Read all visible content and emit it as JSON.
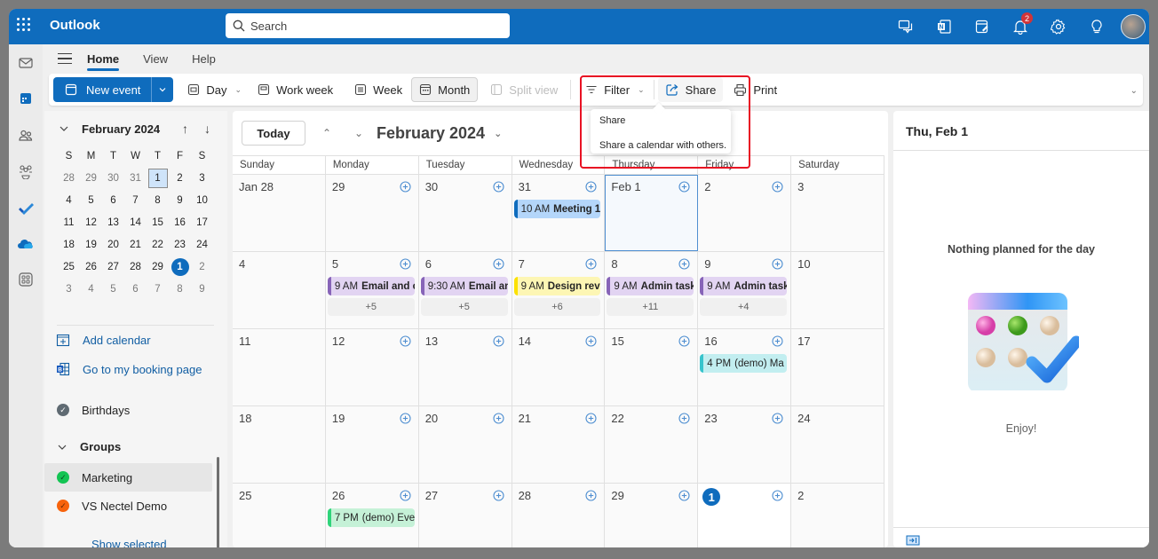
{
  "app": {
    "title": "Outlook",
    "search_placeholder": "Search",
    "notification_count": "2",
    "top_icons": [
      "teams-chat-icon",
      "onenote-icon",
      "my-day-icon",
      "notifications-bell-icon",
      "settings-gear-icon",
      "tips-lightbulb-icon",
      "user-avatar"
    ]
  },
  "rail": {
    "items": [
      "mail",
      "calendar",
      "people",
      "groups",
      "to-do",
      "onedrive",
      "more-apps"
    ],
    "active": "calendar"
  },
  "ribbon": {
    "tabs": [
      {
        "label": "Home",
        "active": true
      },
      {
        "label": "View",
        "active": false
      },
      {
        "label": "Help",
        "active": false
      }
    ],
    "toolbar": {
      "new_event": "New event",
      "day": "Day",
      "work_week": "Work week",
      "week": "Week",
      "month": "Month",
      "split_view": "Split view",
      "filter": "Filter",
      "share": "Share",
      "print": "Print",
      "selected_view": "Month"
    }
  },
  "share_tooltip": {
    "title": "Share",
    "description": "Share a calendar with others."
  },
  "mini_calendar": {
    "title": "February 2024",
    "weekdays": [
      "S",
      "M",
      "T",
      "W",
      "T",
      "F",
      "S"
    ],
    "weeks": [
      [
        {
          "d": "28",
          "m": true
        },
        {
          "d": "29",
          "m": true
        },
        {
          "d": "30",
          "m": true
        },
        {
          "d": "31",
          "m": true
        },
        {
          "d": "1",
          "sel": true
        },
        {
          "d": "2"
        },
        {
          "d": "3"
        }
      ],
      [
        {
          "d": "4"
        },
        {
          "d": "5"
        },
        {
          "d": "6"
        },
        {
          "d": "7"
        },
        {
          "d": "8"
        },
        {
          "d": "9"
        },
        {
          "d": "10"
        }
      ],
      [
        {
          "d": "11"
        },
        {
          "d": "12"
        },
        {
          "d": "13"
        },
        {
          "d": "14"
        },
        {
          "d": "15"
        },
        {
          "d": "16"
        },
        {
          "d": "17"
        }
      ],
      [
        {
          "d": "18"
        },
        {
          "d": "19"
        },
        {
          "d": "20"
        },
        {
          "d": "21"
        },
        {
          "d": "22"
        },
        {
          "d": "23"
        },
        {
          "d": "24"
        }
      ],
      [
        {
          "d": "25"
        },
        {
          "d": "26"
        },
        {
          "d": "27"
        },
        {
          "d": "28"
        },
        {
          "d": "29"
        },
        {
          "d": "1",
          "today": true
        },
        {
          "d": "2",
          "m": true
        }
      ],
      [
        {
          "d": "3",
          "m": true
        },
        {
          "d": "4",
          "m": true
        },
        {
          "d": "5",
          "m": true
        },
        {
          "d": "6",
          "m": true
        },
        {
          "d": "7",
          "m": true
        },
        {
          "d": "8",
          "m": true
        },
        {
          "d": "9",
          "m": true
        }
      ]
    ]
  },
  "sidebar": {
    "add_calendar": "Add calendar",
    "booking_page": "Go to my booking page",
    "birthdays": "Birthdays",
    "birthdays_color": "#5f6a72",
    "groups_label": "Groups",
    "groups": [
      {
        "label": "Marketing",
        "color": "#13c453",
        "active": true
      },
      {
        "label": "VS Nectel Demo",
        "color": "#f7630c",
        "active": false
      }
    ],
    "show_selected": "Show selected"
  },
  "calendar": {
    "today_label": "Today",
    "month_title": "February 2024",
    "weekdays": [
      "Sunday",
      "Monday",
      "Tuesday",
      "Wednesday",
      "Thursday",
      "Friday",
      "Saturday"
    ],
    "weeks": [
      [
        {
          "label": "Jan 28",
          "add": false
        },
        {
          "label": "29",
          "add": true
        },
        {
          "label": "30",
          "add": true
        },
        {
          "label": "31",
          "add": true,
          "event": {
            "time": "10 AM",
            "title": "Meeting 1",
            "bg": "#b4d6fa",
            "bar": "#0f6cbd"
          }
        },
        {
          "label": "Feb 1",
          "add": true,
          "selected": true
        },
        {
          "label": "2",
          "add": true
        },
        {
          "label": "3",
          "add": false
        }
      ],
      [
        {
          "label": "4",
          "add": false
        },
        {
          "label": "5",
          "add": true,
          "event": {
            "time": "9 AM",
            "title": "Email and c",
            "bg": "#e2d4f2",
            "bar": "#8764b8"
          },
          "more": "+5"
        },
        {
          "label": "6",
          "add": true,
          "event": {
            "time": "9:30 AM",
            "title": "Email an",
            "bg": "#e2d4f2",
            "bar": "#8764b8"
          },
          "more": "+5"
        },
        {
          "label": "7",
          "add": true,
          "event": {
            "time": "9 AM",
            "title": "Design revi",
            "bg": "#fdf6b4",
            "bar": "#fce100"
          },
          "more": "+6"
        },
        {
          "label": "8",
          "add": true,
          "event": {
            "time": "9 AM",
            "title": "Admin task",
            "bg": "#e2d4f2",
            "bar": "#8764b8"
          },
          "more": "+11"
        },
        {
          "label": "9",
          "add": true,
          "event": {
            "time": "9 AM",
            "title": "Admin task",
            "bg": "#e2d4f2",
            "bar": "#8764b8"
          },
          "more": "+4"
        },
        {
          "label": "10",
          "add": false
        }
      ],
      [
        {
          "label": "11",
          "add": false
        },
        {
          "label": "12",
          "add": true
        },
        {
          "label": "13",
          "add": true
        },
        {
          "label": "14",
          "add": true
        },
        {
          "label": "15",
          "add": true
        },
        {
          "label": "16",
          "add": true,
          "event": {
            "time": "4 PM",
            "title": "(demo) Ma",
            "bg": "#c2eef0",
            "bar": "#38c4cc",
            "plain": true
          }
        },
        {
          "label": "17",
          "add": false
        }
      ],
      [
        {
          "label": "18",
          "add": false
        },
        {
          "label": "19",
          "add": true
        },
        {
          "label": "20",
          "add": true
        },
        {
          "label": "21",
          "add": true
        },
        {
          "label": "22",
          "add": true
        },
        {
          "label": "23",
          "add": true
        },
        {
          "label": "24",
          "add": false
        }
      ],
      [
        {
          "label": "25",
          "add": false
        },
        {
          "label": "26",
          "add": true,
          "event": {
            "time": "7 PM",
            "title": "(demo) Eve",
            "bg": "#c5f1d7",
            "bar": "#2fd47a",
            "plain": true
          }
        },
        {
          "label": "27",
          "add": true
        },
        {
          "label": "28",
          "add": true
        },
        {
          "label": "29",
          "add": true
        },
        {
          "label": "1",
          "add": true,
          "today": true
        },
        {
          "label": "2",
          "add": false
        }
      ]
    ]
  },
  "right_pane": {
    "title": "Thu, Feb 1",
    "empty_heading": "Nothing planned for the day",
    "empty_sub": "Enjoy!"
  },
  "colors": {
    "brand": "#0f6cbd",
    "highlight": "#e81123"
  }
}
